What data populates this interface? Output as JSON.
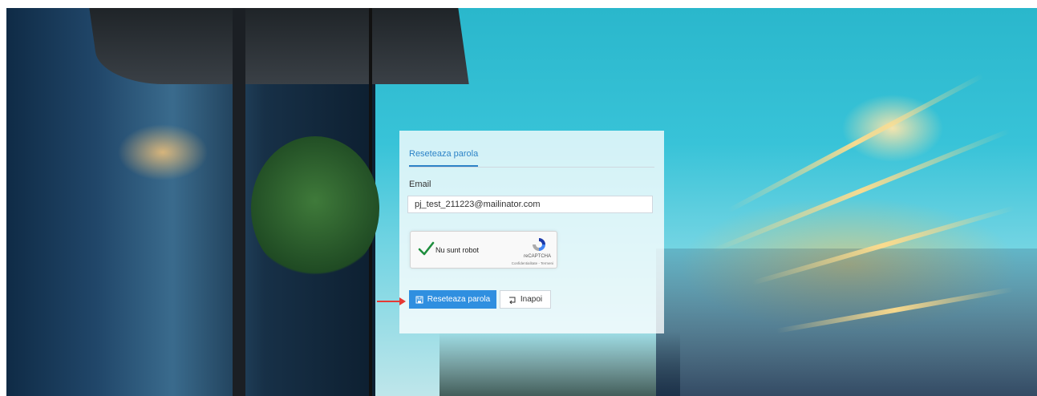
{
  "form": {
    "tab_label": "Reseteaza parola",
    "email_label": "Email",
    "email_value": "pj_test_211223@mailinator.com",
    "email_placeholder": "",
    "recaptcha": {
      "checkbox_label": "Nu sunt robot",
      "brand": "reCAPTCHA",
      "links": "Confidentialitate - Termeni",
      "checked": true
    },
    "submit_label": "Reseteaza parola",
    "back_label": "Inapoi"
  },
  "colors": {
    "accent": "#2f8fe0",
    "tab_active": "#2d83c7",
    "check_green": "#1e8e3e",
    "annotation_red": "#e53935"
  },
  "icons": {
    "submit": "save-icon",
    "back": "back-arrow-icon",
    "recaptcha": "recaptcha-logo-icon"
  }
}
